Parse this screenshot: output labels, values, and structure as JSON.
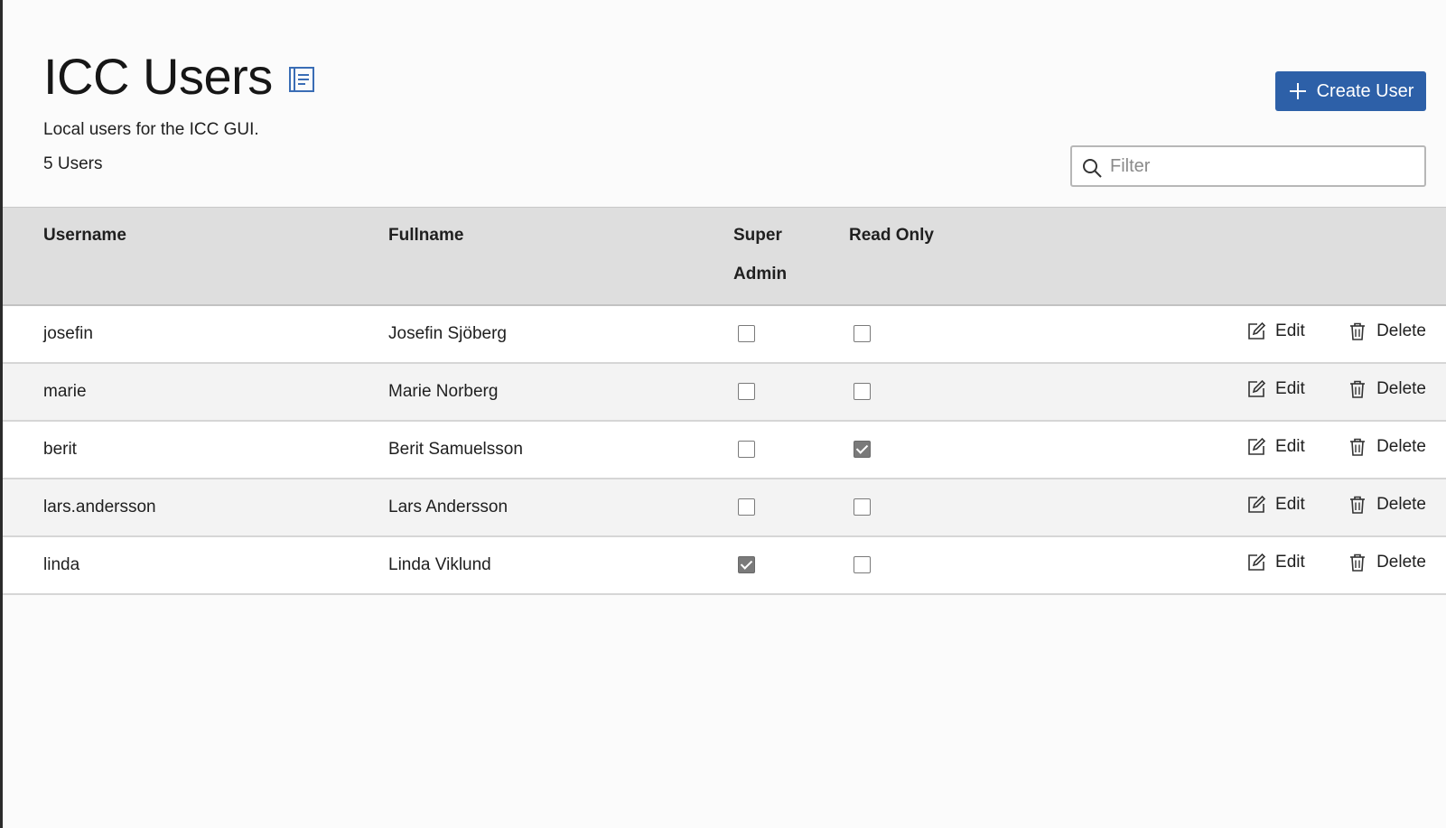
{
  "header": {
    "title": "ICC Users",
    "subtitle": "Local users for the ICC GUI.",
    "count": "5 Users",
    "create_label": "Create User",
    "filter_placeholder": "Filter"
  },
  "table": {
    "columns": {
      "username": "Username",
      "fullname": "Fullname",
      "super_admin_line1": "Super",
      "super_admin_line2": "Admin",
      "read_only": "Read Only"
    },
    "edit_label": "Edit",
    "delete_label": "Delete",
    "rows": [
      {
        "username": "josefin",
        "fullname": "Josefin Sjöberg",
        "super_admin": false,
        "read_only": false
      },
      {
        "username": "marie",
        "fullname": "Marie Norberg",
        "super_admin": false,
        "read_only": false
      },
      {
        "username": "berit",
        "fullname": "Berit Samuelsson",
        "super_admin": false,
        "read_only": true
      },
      {
        "username": "lars.andersson",
        "fullname": "Lars Andersson",
        "super_admin": false,
        "read_only": false
      },
      {
        "username": "linda",
        "fullname": "Linda Viklund",
        "super_admin": true,
        "read_only": false
      }
    ]
  },
  "colors": {
    "accent": "#2d60a8",
    "header_bg": "#dedede",
    "icon_blue": "#3a6db5"
  },
  "icons": {
    "doc": "document-icon",
    "plus": "plus-icon",
    "search": "search-icon",
    "edit": "edit-icon",
    "delete": "trash-icon"
  }
}
